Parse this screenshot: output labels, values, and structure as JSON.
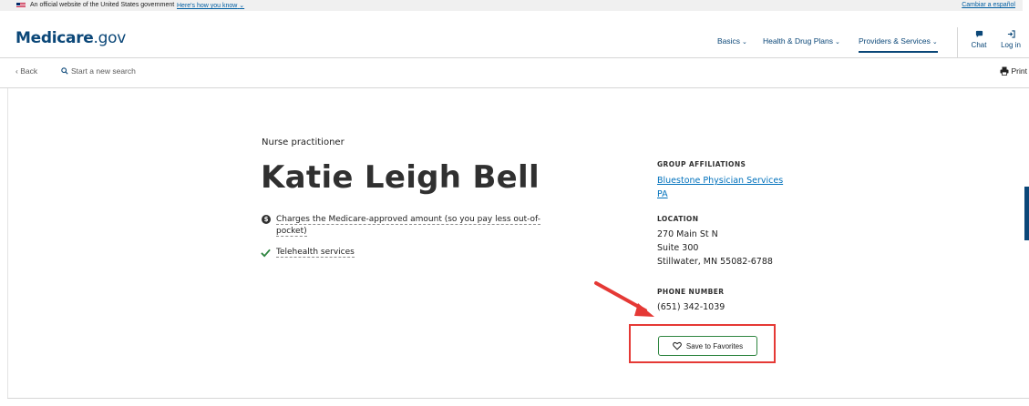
{
  "gov_banner": {
    "official_text": "An official website of the United States government",
    "how_text": "Here's how you know",
    "spanish_link": "Cambiar a español"
  },
  "header": {
    "logo_bold": "Medicare",
    "logo_suffix": ".gov",
    "nav": [
      {
        "label": "Basics"
      },
      {
        "label": "Health & Drug Plans"
      },
      {
        "label": "Providers & Services",
        "active": true
      }
    ],
    "chat_label": "Chat",
    "login_label": "Log in"
  },
  "subnav": {
    "back_label": "Back",
    "search_label": "Start a new search",
    "print_label": "Print"
  },
  "provider": {
    "role": "Nurse practitioner",
    "name": "Katie Leigh Bell",
    "features": [
      {
        "line1": "Charges the Medicare-approved amount (so you pay less out-of-",
        "line2": "pocket)",
        "icon": "dollar-icon"
      },
      {
        "line1": "Telehealth services",
        "icon": "check-icon"
      }
    ],
    "group_affiliations_label": "GROUP AFFILIATIONS",
    "affiliation_line1": "Bluestone Physician Services",
    "affiliation_line2": "PA",
    "location_label": "LOCATION",
    "address": [
      "270 Main St N",
      "Suite 300",
      "Stillwater, MN 55082-6788"
    ],
    "phone_label": "PHONE NUMBER",
    "phone": "(651) 342-1039",
    "save_button_label": "Save to Favorites"
  },
  "colors": {
    "brand_navy": "#0b4778",
    "link_blue": "#0071bc",
    "button_border_green": "#2e8540",
    "annotation_red": "#e53935"
  }
}
